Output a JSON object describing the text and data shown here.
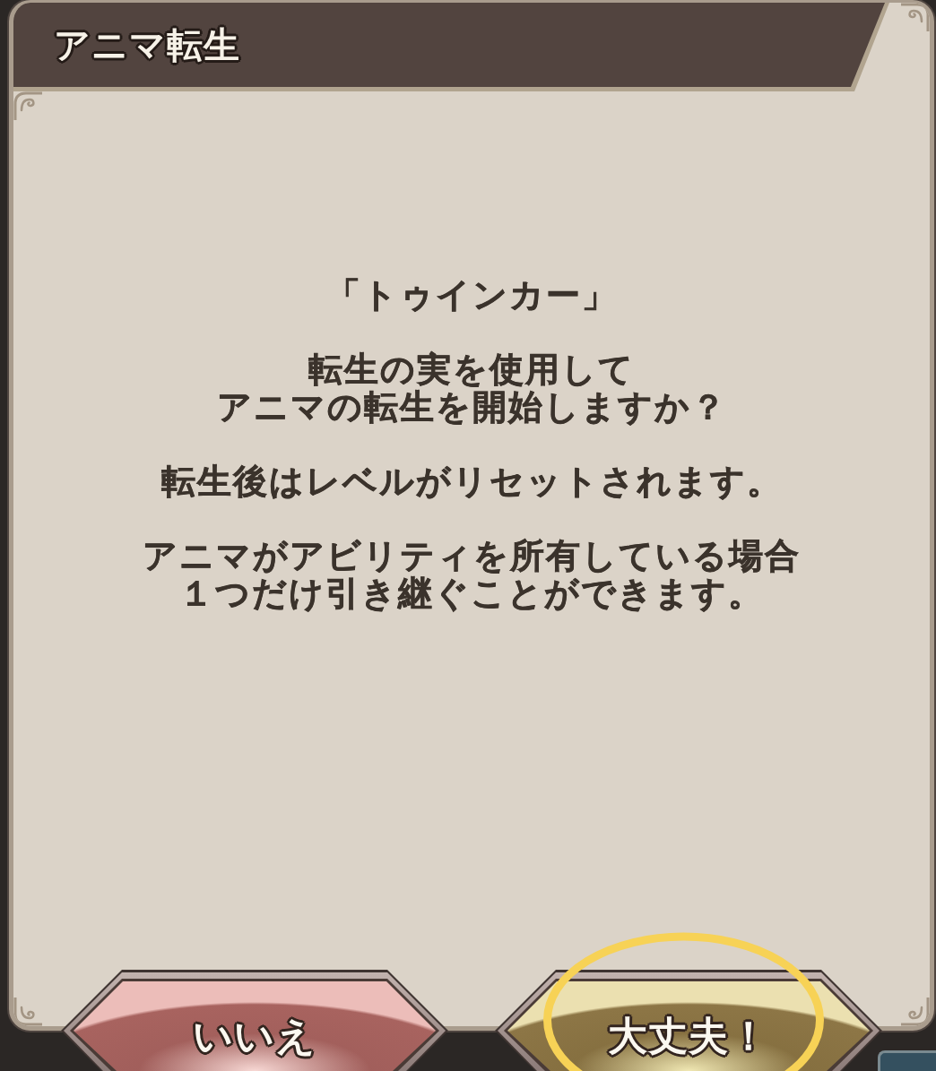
{
  "dialog": {
    "title": "アニマ転生",
    "paragraphs": [
      [
        "「トゥインカー」"
      ],
      [
        "転生の実を使用して",
        "アニマの転生を開始しますか？"
      ],
      [
        "転生後はレベルがリセットされます。"
      ],
      [
        "アニマがアビリティを所有している場合",
        "１つだけ引き継ぐことができます。"
      ]
    ]
  },
  "buttons": [
    {
      "label": "いいえ",
      "kind": "cancel",
      "highlighted": false
    },
    {
      "label": "大丈夫！",
      "kind": "confirm",
      "highlighted": true
    }
  ]
}
